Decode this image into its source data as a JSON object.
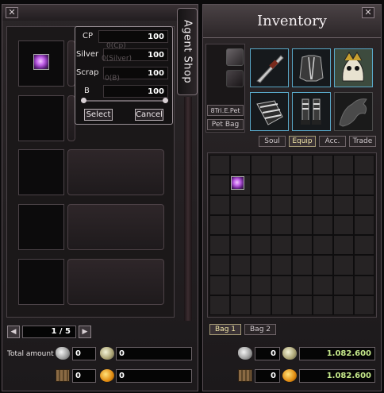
{
  "agent_shop": {
    "title": "Agent Shop",
    "close_label": "✕",
    "page_indicator": "1 / 5",
    "total_amount_label": "Total amount",
    "totals": {
      "silver": "0",
      "silver2": "0",
      "scrap": "0",
      "b": "0"
    }
  },
  "price_popup": {
    "rows": [
      {
        "label": "CP",
        "value": "100",
        "ghost": ""
      },
      {
        "label": "Silver",
        "value": "100",
        "ghost": "0(Cp)"
      },
      {
        "label": "Scrap",
        "value": "100",
        "ghost": "0(Silver)"
      },
      {
        "label": "B",
        "value": "100",
        "ghost": "0(B)"
      }
    ],
    "select_label": "Select",
    "cancel_label": "Cancel"
  },
  "inventory": {
    "title": "Inventory",
    "close_label": "✕",
    "side_tabs": [
      "8Tri.E.Pet",
      "Pet Bag"
    ],
    "category_tabs": [
      {
        "label": "Soul",
        "active": false
      },
      {
        "label": "Equip",
        "active": true
      },
      {
        "label": "Acc.",
        "active": false
      },
      {
        "label": "Trade",
        "active": false
      }
    ],
    "bag_tabs": [
      {
        "label": "Bag 1",
        "active": true
      },
      {
        "label": "Bag 2",
        "active": false
      }
    ],
    "currency_rows": [
      {
        "small": "0",
        "big": "1.082.600"
      },
      {
        "small": "0",
        "big": "1.082.600"
      }
    ]
  },
  "colors": {
    "accent": "#c5e88a",
    "equip_border": "#59a8c8",
    "panel_border": "#5a5056"
  }
}
